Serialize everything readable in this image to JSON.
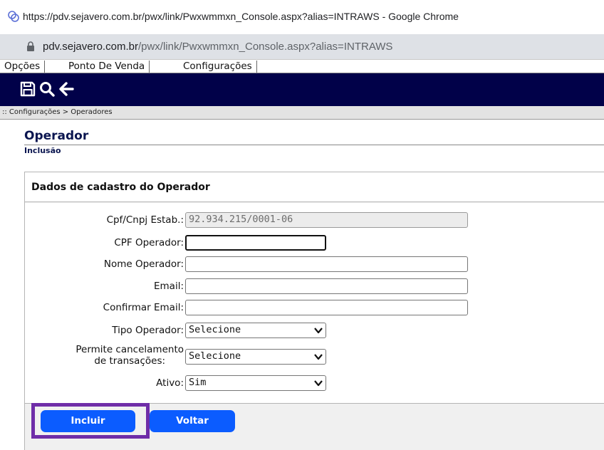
{
  "browser": {
    "window_title": "https://pdv.sejavero.com.br/pwx/link/Pwxwmmxn_Console.aspx?alias=INTRAWS - Google Chrome",
    "url_host": "pdv.sejavero.com.br",
    "url_path": "/pwx/link/Pwxwmmxn_Console.aspx?alias=INTRAWS",
    "favicon": "link-icon",
    "lock_icon": "lock-icon"
  },
  "menu": {
    "items": [
      {
        "label": "Opções"
      },
      {
        "label": "Ponto De Venda"
      },
      {
        "label": "Configurações"
      }
    ]
  },
  "toolbar": {
    "icons": [
      "save-icon",
      "search-icon",
      "back-arrow-icon"
    ],
    "background": "#010149"
  },
  "breadcrumb": ":: Configurações > Operadores",
  "page": {
    "title": "Operador",
    "subtitle": "Inclusão"
  },
  "panel": {
    "header": "Dados de cadastro do Operador",
    "fields": {
      "cpf_cnpj_estab": {
        "label": "Cpf/Cnpj Estab.:",
        "value": "92.934.215/0001-06"
      },
      "cpf_operador": {
        "label": "CPF Operador:",
        "value": ""
      },
      "nome_operador": {
        "label": "Nome Operador:",
        "value": ""
      },
      "email": {
        "label": "Email:",
        "value": ""
      },
      "confirmar_email": {
        "label": "Confirmar Email:",
        "value": ""
      },
      "tipo_operador": {
        "label": "Tipo Operador:",
        "selected": "Selecione"
      },
      "permite_cancelamento": {
        "label_line1": "Permite cancelamento",
        "label_line2": "de transações:",
        "selected": "Selecione"
      },
      "ativo": {
        "label": "Ativo:",
        "selected": "Sim"
      }
    }
  },
  "buttons": {
    "incluir": "Incluir",
    "voltar": "Voltar"
  },
  "colors": {
    "button": "#0b5cff",
    "highlight": "#6f2da8",
    "title": "#0b1650"
  }
}
